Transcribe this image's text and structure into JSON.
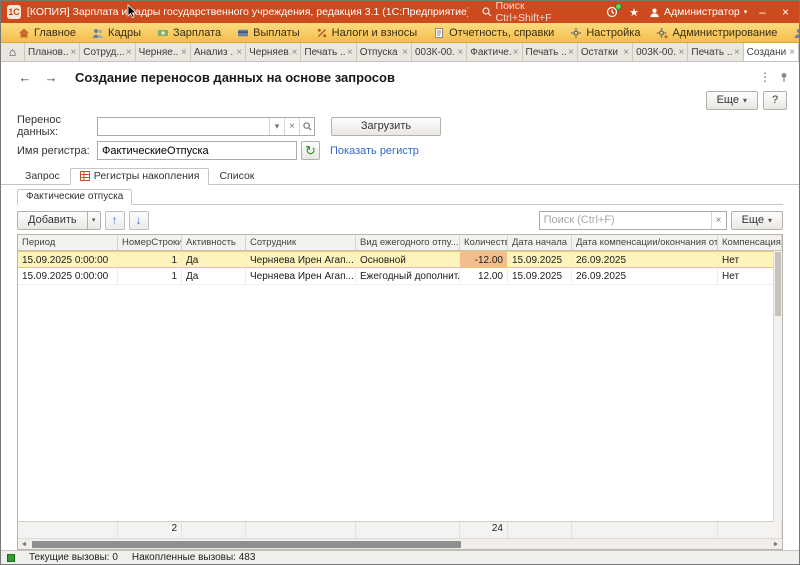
{
  "icons": {
    "close": "×",
    "home": "⌂",
    "dropdown": "▾",
    "back": "←",
    "forward": "→",
    "up": "↑",
    "down": "↓",
    "refresh": "↻",
    "kebab": "⋮",
    "star": "★",
    "minimize": "–",
    "scroll_left": "◄",
    "scroll_right": "►",
    "logo": "1С"
  },
  "titlebar": {
    "app_title": "[КОПИЯ] Зарплата и кадры государственного учреждения, редакция 3.1  (1С:Предприятие)",
    "search_placeholder": "Поиск Ctrl+Shift+F",
    "user": "Администратор"
  },
  "menubar": {
    "items": [
      {
        "label": "Главное"
      },
      {
        "label": "Кадры"
      },
      {
        "label": "Зарплата"
      },
      {
        "label": "Выплаты"
      },
      {
        "label": "Налоги и взносы"
      },
      {
        "label": "Отчетность, справки"
      },
      {
        "label": "Настройка"
      },
      {
        "label": "Администрирование"
      },
      {
        "label": "Сотрудники"
      }
    ]
  },
  "tabbar": {
    "tabs": [
      {
        "label": "Планов..."
      },
      {
        "label": "Сотруд..."
      },
      {
        "label": "Черняе..."
      },
      {
        "label": "Анализ ..."
      },
      {
        "label": "Черняев..."
      },
      {
        "label": "Печать ..."
      },
      {
        "label": "Отпуска"
      },
      {
        "label": "003К-00..."
      },
      {
        "label": "Фактиче..."
      },
      {
        "label": "Печать ..."
      },
      {
        "label": "Остатки ..."
      },
      {
        "label": "003К-00..."
      },
      {
        "label": "Печать ..."
      },
      {
        "label": "Создани..."
      }
    ]
  },
  "page": {
    "title": "Создание переносов данных на основе запросов",
    "more_button": "Еще",
    "help_button": "?"
  },
  "form": {
    "transfer_label": "Перенос данных:",
    "transfer_value": "",
    "load_button": "Загрузить",
    "register_label": "Имя регистра:",
    "register_value": "ФактическиеОтпуска",
    "show_register_link": "Показать регистр"
  },
  "view_tabs": {
    "query": "Запрос",
    "registers": "Регистры накопления",
    "list": "Список"
  },
  "register_page": {
    "tab": "Фактические отпуска"
  },
  "toolbar": {
    "add_button": "Добавить",
    "search_placeholder": "Поиск (Ctrl+F)",
    "more_button": "Еще"
  },
  "table": {
    "columns": [
      "Период",
      "НомерСтроки",
      "Активность",
      "Сотрудник",
      "Вид ежегодного отпу...",
      "Количество",
      "Дата начала",
      "Дата компенсации/окончания отпуска",
      "Компенсация"
    ],
    "rows": [
      {
        "period": "15.09.2025 0:00:00",
        "line_number": "1",
        "active": "Да",
        "employee": "Черняева Ирен Агап...",
        "vacation_type": "Основной",
        "quantity": "-12.00",
        "start_date": "15.09.2025",
        "end_date": "26.09.2025",
        "compensation": "Нет"
      },
      {
        "period": "15.09.2025 0:00:00",
        "line_number": "1",
        "active": "Да",
        "employee": "Черняева Ирен Агап...",
        "vacation_type": "Ежегодный дополнит...",
        "quantity": "12.00",
        "start_date": "15.09.2025",
        "end_date": "26.09.2025",
        "compensation": "Нет"
      }
    ],
    "totals": {
      "line_count": "2",
      "quantity_total": "24"
    }
  },
  "statusbar": {
    "current_calls": "Текущие вызовы: 0",
    "accumulated_calls": "Накопленные вызовы: 483"
  }
}
